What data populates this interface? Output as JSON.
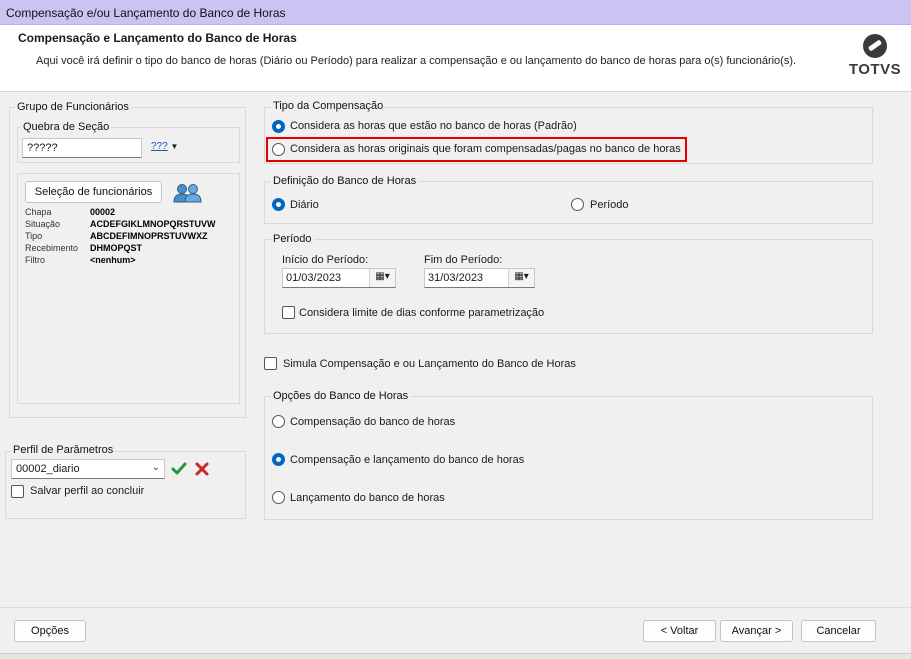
{
  "window": {
    "title": "Compensação e/ou Lançamento do Banco de Horas"
  },
  "header": {
    "title": "Compensação e Lançamento do Banco de Horas",
    "description": "Aqui você irá definir o tipo do banco de horas (Diário ou Período) para realizar a compensação e ou lançamento do banco de horas para o(s) funcionário(s).",
    "logo_text": "TOTVS"
  },
  "grupo_funcionarios": {
    "title": "Grupo de Funcionários",
    "quebra_secao": {
      "title": "Quebra de Seção",
      "value": "?????",
      "dropdown_label": "???"
    },
    "selecao_button": "Seleção de funcionários",
    "info": [
      {
        "key": "Chapa",
        "value": "00002"
      },
      {
        "key": "Situação",
        "value": "ACDEFGIKLMNOPQRSTUVW"
      },
      {
        "key": "Tipo",
        "value": "ABCDEFIMNOPRSTUVWXZ"
      },
      {
        "key": "Recebimento",
        "value": "DHMOPQST"
      },
      {
        "key": "Filtro",
        "value": "<nenhum>"
      }
    ]
  },
  "perfil": {
    "title": "Perfil de Parâmetros",
    "value": "00002_diario",
    "salvar_label": "Salvar perfil ao concluir"
  },
  "tipo_compensacao": {
    "title": "Tipo da Compensação",
    "options": [
      {
        "label": "Considera as horas que estão no banco de horas (Padrão)",
        "selected": true
      },
      {
        "label": "Considera as horas originais que foram compensadas/pagas no banco de horas",
        "selected": false
      }
    ]
  },
  "definicao": {
    "title": "Definição do Banco de Horas",
    "options": [
      {
        "label": "Diário",
        "selected": true
      },
      {
        "label": "Período",
        "selected": false
      }
    ]
  },
  "periodo": {
    "title": "Período",
    "inicio_label": "Início do Período:",
    "inicio_value": "01/03/2023",
    "fim_label": "Fim do Período:",
    "fim_value": "31/03/2023",
    "limite_label": "Considera limite de dias conforme parametrização"
  },
  "simula_label": "Simula Compensação e ou Lançamento do Banco de Horas",
  "opcoes_banco": {
    "title": "Opções do Banco de Horas",
    "options": [
      {
        "label": "Compensação do banco de horas",
        "selected": false
      },
      {
        "label": "Compensação e lançamento do banco de horas",
        "selected": true
      },
      {
        "label": "Lançamento do banco de horas",
        "selected": false
      }
    ]
  },
  "footer": {
    "opcoes": "Opções",
    "voltar": "< Voltar",
    "avancar": "Avançar >",
    "cancelar": "Cancelar"
  },
  "colors": {
    "accent": "#0067c0",
    "titlebar": "#cbc4f2",
    "highlight": "#e00000"
  }
}
